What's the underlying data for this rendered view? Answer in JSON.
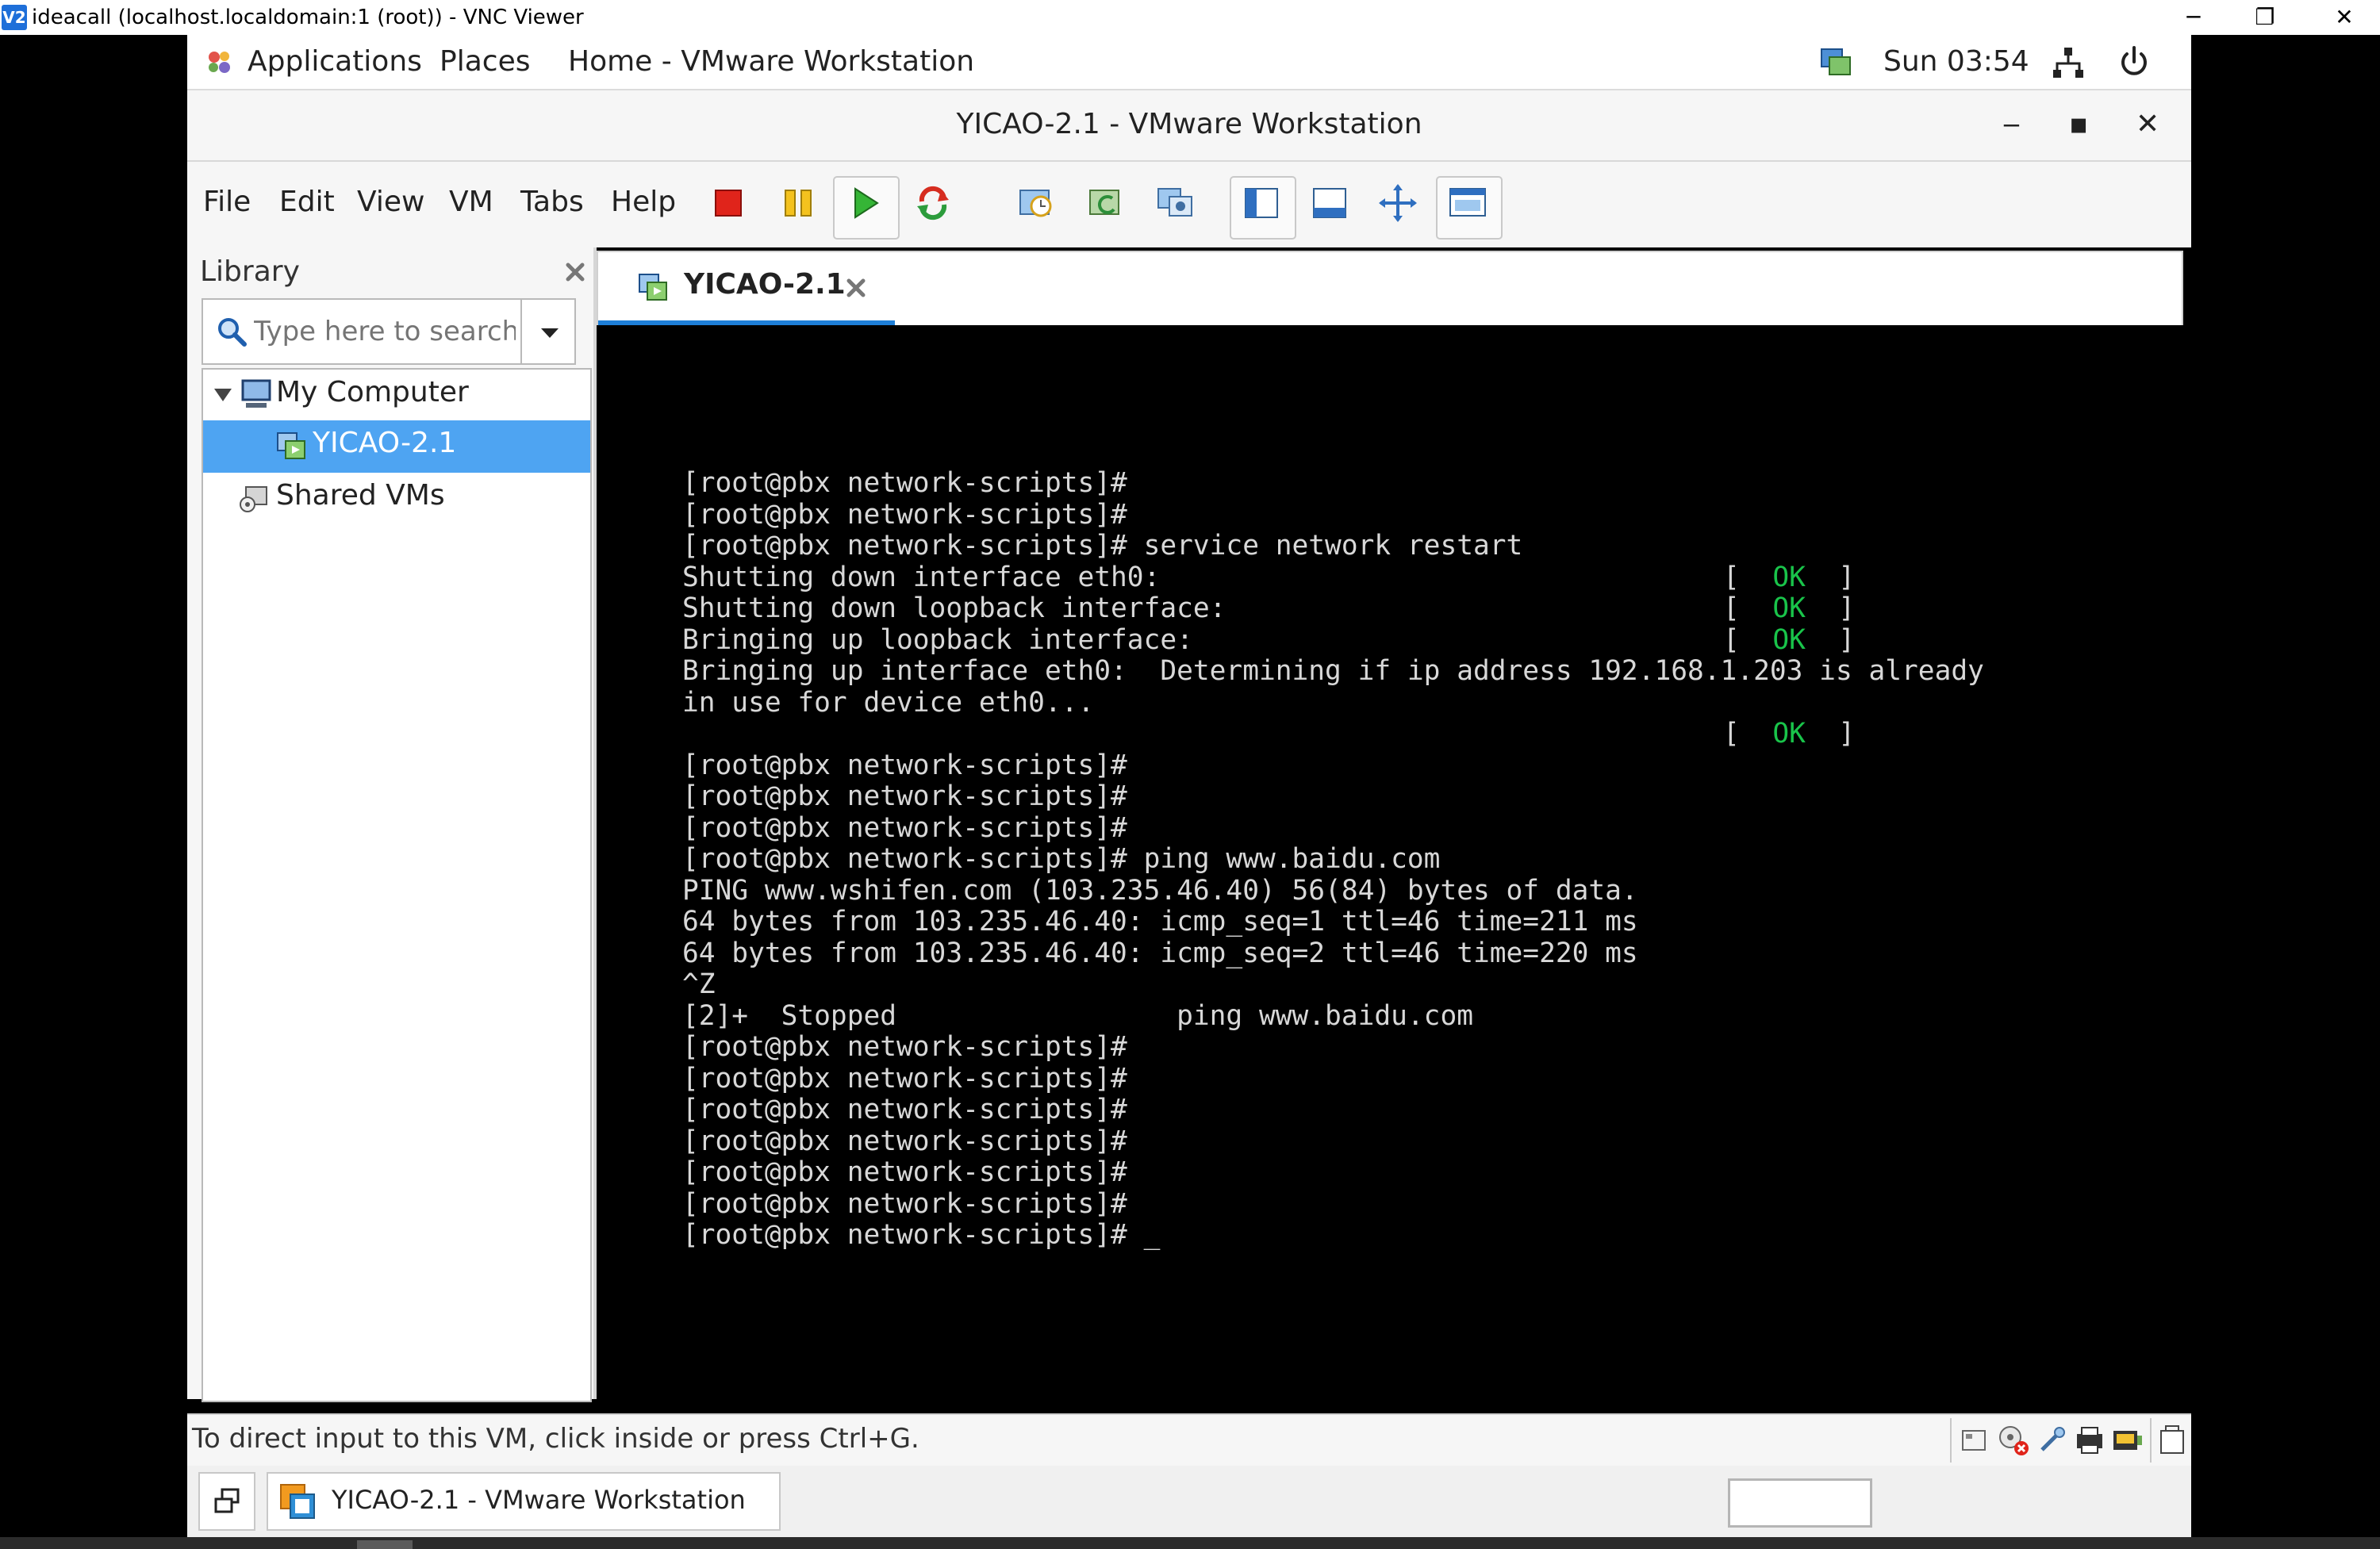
{
  "vnc": {
    "logo_text": "V2",
    "title": "ideacall (localhost.localdomain:1 (root)) - VNC Viewer",
    "controls": {
      "minimize": "─",
      "restore": "❐",
      "close": "✕"
    }
  },
  "gnome": {
    "applications": "Applications",
    "places": "Places",
    "active_app": "Home - VMware Workstation",
    "clock": "Sun 03:54"
  },
  "vmware": {
    "window_title": "YICAO-2.1 - VMware Workstation",
    "window_controls": {
      "minimize": "‒",
      "maximize": "▪",
      "close": "✕"
    },
    "menu": [
      "File",
      "Edit",
      "View",
      "VM",
      "Tabs",
      "Help"
    ]
  },
  "library": {
    "title": "Library",
    "search_placeholder": "Type here to search",
    "tree": {
      "my_computer": "My Computer",
      "vm": "YICAO-2.1",
      "shared_vms": "Shared VMs"
    }
  },
  "tab": {
    "label": "YICAO-2.1"
  },
  "console": {
    "lines": [
      "[root@pbx network-scripts]#",
      "[root@pbx network-scripts]#",
      "[root@pbx network-scripts]# service network restart",
      "Shutting down interface eth0:",
      "Shutting down loopback interface:",
      "Bringing up loopback interface:",
      "Bringing up interface eth0:  Determining if ip address 192.168.1.203 is already",
      "in use for device eth0...",
      "",
      "[root@pbx network-scripts]#",
      "[root@pbx network-scripts]#",
      "[root@pbx network-scripts]#",
      "[root@pbx network-scripts]# ping www.baidu.com",
      "PING www.wshifen.com (103.235.46.40) 56(84) bytes of data.",
      "64 bytes from 103.235.46.40: icmp_seq=1 ttl=46 time=211 ms",
      "64 bytes from 103.235.46.40: icmp_seq=2 ttl=46 time=220 ms",
      "^Z",
      "[2]+  Stopped                 ping www.baidu.com",
      "[root@pbx network-scripts]#",
      "[root@pbx network-scripts]#",
      "[root@pbx network-scripts]#",
      "[root@pbx network-scripts]#",
      "[root@pbx network-scripts]#",
      "[root@pbx network-scripts]#",
      "[root@pbx network-scripts]# _"
    ],
    "ok_open": "[",
    "ok_text": "OK",
    "ok_close": "]"
  },
  "status": {
    "text": "To direct input to this VM, click inside or press Ctrl+G."
  },
  "taskbar": {
    "window_label": "YICAO-2.1 - VMware Workstation"
  },
  "colors": {
    "accent": "#1e7fd8",
    "selection": "#4ea4f2",
    "ok_green": "#19c44a",
    "terminal_bg": "#000000"
  }
}
